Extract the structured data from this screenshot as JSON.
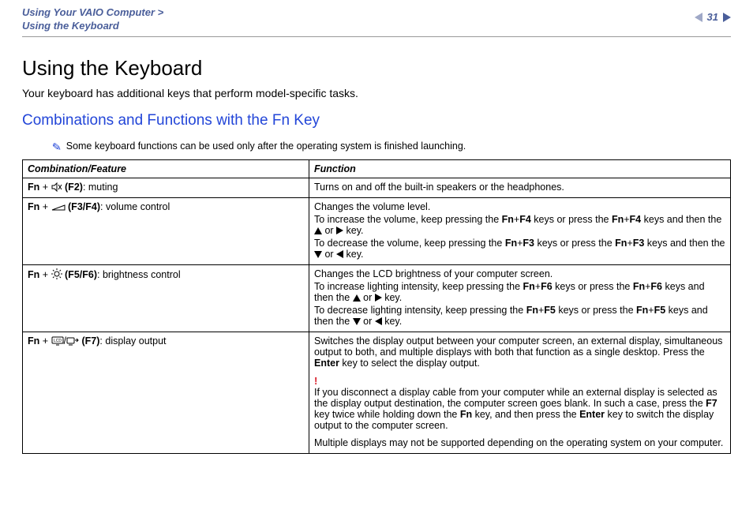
{
  "breadcrumb": {
    "line1": "Using Your VAIO Computer >",
    "line2": "Using the Keyboard"
  },
  "page_number": "31",
  "title": "Using the Keyboard",
  "intro": "Your keyboard has additional keys that perform model-specific tasks.",
  "subtitle": "Combinations and Functions with the Fn Key",
  "note": "Some keyboard functions can be used only after the operating system is finished launching.",
  "table": {
    "header": {
      "col1": "Combination/Feature",
      "col2": "Function"
    },
    "rows": [
      {
        "combo_prefix": "Fn",
        "combo_key": "(F2)",
        "combo_label": ": muting",
        "func1": "Turns on and off the built-in speakers or the headphones."
      },
      {
        "combo_prefix": "Fn",
        "combo_key": "(F3/F4)",
        "combo_label": ": volume control",
        "func1": "Changes the volume level.",
        "func2a": "To increase the volume, keep pressing the ",
        "k1": "Fn",
        "k2": "F4",
        "mid1": " keys or press the ",
        "k3": "Fn",
        "k4": "F4",
        "tail1": " keys and then the ",
        "end1": " key.",
        "func3a": "To decrease the volume, keep pressing the ",
        "k5": "Fn",
        "k6": "F3",
        "mid2": " keys or press the ",
        "k7": "Fn",
        "k8": "F3",
        "tail2": " keys and then the ",
        "end2": " key.",
        "or": " or "
      },
      {
        "combo_prefix": "Fn",
        "combo_key": "(F5/F6)",
        "combo_label": ": brightness control",
        "func1": "Changes the LCD brightness of your computer screen.",
        "func2a": "To increase lighting intensity, keep pressing the ",
        "k1": "Fn",
        "k2": "F6",
        "mid1": " keys or press the ",
        "k3": "Fn",
        "k4": "F6",
        "tail1": " keys and then the ",
        "end1": " key.",
        "func3a": "To decrease lighting intensity, keep pressing the ",
        "k5": "Fn",
        "k6": "F5",
        "mid2": " keys or press the ",
        "k7": "Fn",
        "k8": "F5",
        "tail2": " keys and then the ",
        "end2": " key.",
        "or": " or "
      },
      {
        "combo_prefix": "Fn",
        "combo_key": "(F7)",
        "combo_label": ": display output",
        "p1a": "Switches the display output between your computer screen, an external display, simultaneous output to both, and multiple displays with both that function as a single desktop. Press the ",
        "p1b": "Enter",
        "p1c": " key to select the display output.",
        "warn": "!",
        "p2a": "If you disconnect a display cable from your computer while an external display is selected as the display output destination, the computer screen goes blank. In such a case, press the ",
        "p2b": "F7",
        "p2c": " key twice while holding down the ",
        "p2d": "Fn",
        "p2e": " key, and then press the ",
        "p2f": "Enter",
        "p2g": " key to switch the display output to the computer screen.",
        "p3": "Multiple displays may not be supported depending on the operating system on your computer."
      }
    ]
  }
}
